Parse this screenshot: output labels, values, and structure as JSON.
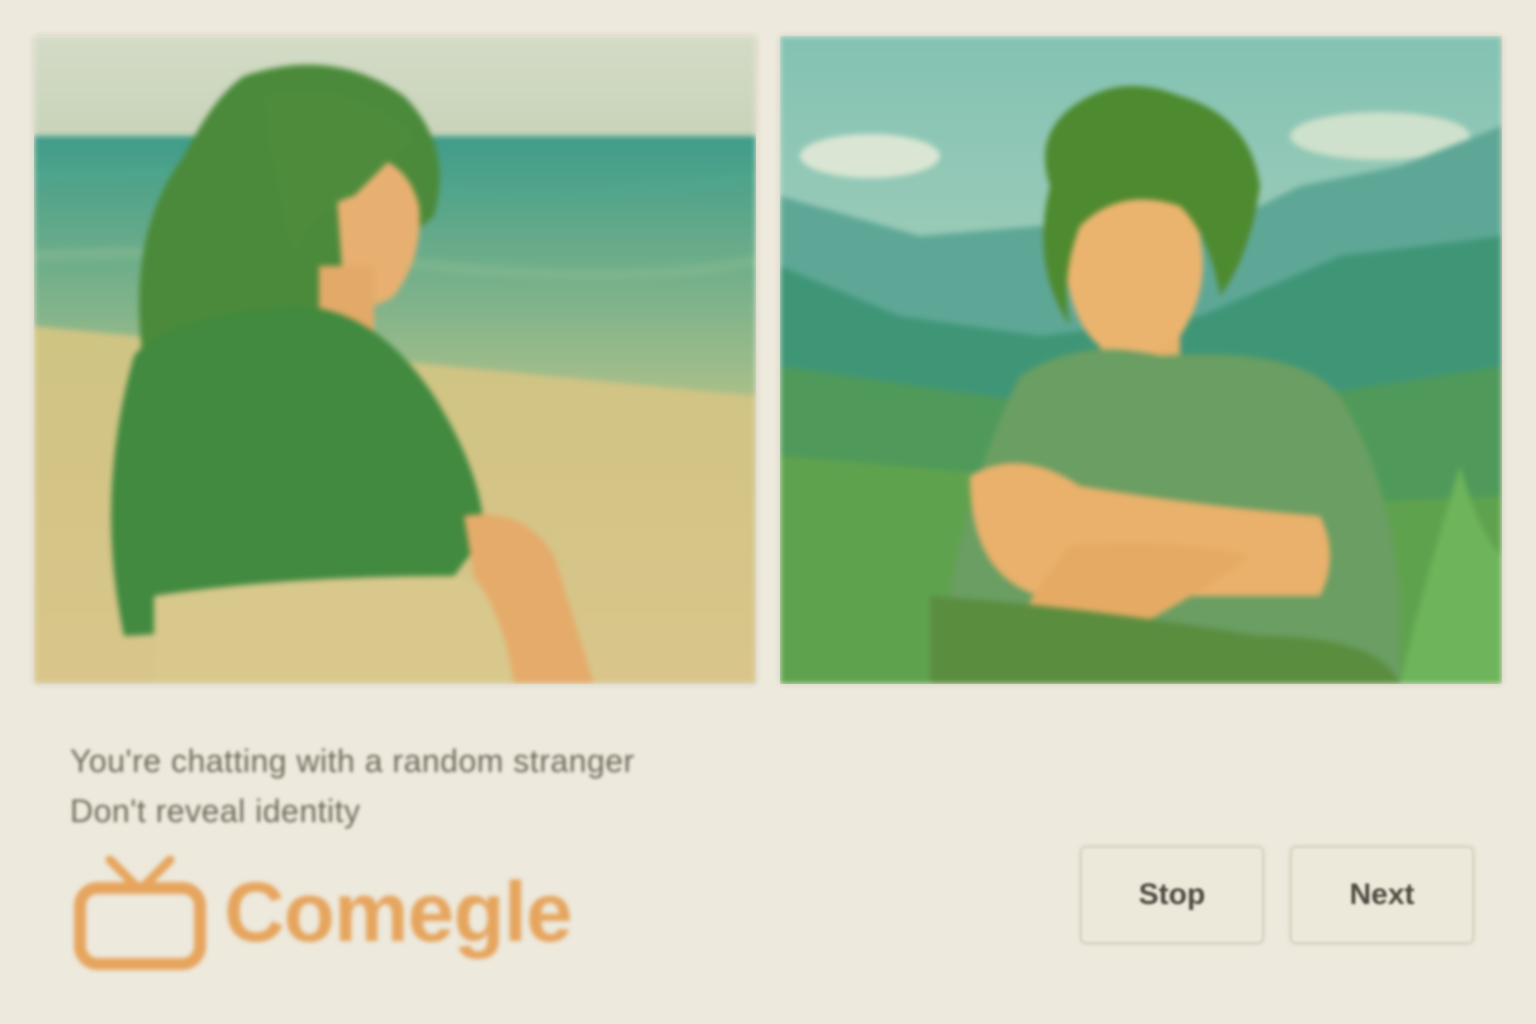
{
  "app": {
    "name": "Comegle",
    "brand_color": "#e6a55e"
  },
  "videos": {
    "stranger_feed": {
      "icon": "video-feed-beach"
    },
    "self_feed": {
      "icon": "video-feed-mountains"
    }
  },
  "disclaimer": {
    "line1": "You're chatting with a random stranger",
    "line2": "Don't reveal identity"
  },
  "controls": {
    "stop_label": "Stop",
    "next_label": "Next"
  }
}
